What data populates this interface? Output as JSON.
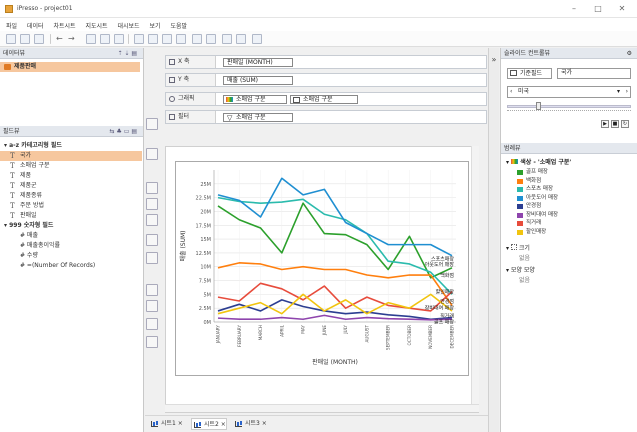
{
  "window": {
    "title": "iPresso - project01",
    "min": "–",
    "max": "□",
    "close": "✕"
  },
  "menu": [
    "파일",
    "데이터",
    "차트시트",
    "지도시트",
    "대시보드",
    "보기",
    "도움말"
  ],
  "left_panel": {
    "datasource_title": "데이터뷰",
    "datasource_item": "제품판매",
    "fields_title": "필드뷰",
    "groups": [
      {
        "label": "▾ a-z 카테고리형 필드",
        "items": [
          "국가",
          "소매업 구분",
          "제품",
          "제품군",
          "제품종류",
          "주문 방법",
          "판매일"
        ]
      },
      {
        "label": "▾ 999 숫자형 필드",
        "items": [
          "# 매출",
          "# 매출총이익률",
          "# 수량",
          "# =(Number Of Records)"
        ]
      }
    ],
    "selected_field": "국가"
  },
  "shelves": {
    "x": {
      "label": "X 축",
      "pill": "판매일 (MONTH)"
    },
    "y": {
      "label": "Y 축",
      "pill": "매출 (SUM)"
    },
    "graphic": {
      "label": "그래픽",
      "pill1": "소매업 구분",
      "pill2": "소매업 구분"
    },
    "filter": {
      "label": "필터",
      "pill": "소매업 구분"
    }
  },
  "right_panel": {
    "slider_title": "슬라이드 컨트롤뷰",
    "base_field_label": "기준필드",
    "base_field_value": "국가",
    "dropdown_value": "미국",
    "legend_title": "범례뷰",
    "color_legend_title": "색상 - '소매업 구분'",
    "legend_items": [
      {
        "label": "골프 매장",
        "color": "#2ca02c"
      },
      {
        "label": "백화점",
        "color": "#ff7f0e"
      },
      {
        "label": "스포츠 매장",
        "color": "#2bbbad"
      },
      {
        "label": "아웃도어 매장",
        "color": "#1f8fd1"
      },
      {
        "label": "안경점",
        "color": "#2c3e91"
      },
      {
        "label": "장비대여 매장",
        "color": "#8e44ad"
      },
      {
        "label": "직거래",
        "color": "#e74c3c"
      },
      {
        "label": "할인매장",
        "color": "#f1c40f"
      }
    ],
    "size_title": "크기",
    "size_value": "없음",
    "shape_title": "모양 모양",
    "shape_value": "없음"
  },
  "tabs": [
    "시트1",
    "시트2",
    "시트3"
  ],
  "chart_data": {
    "type": "line",
    "xlabel": "판매일 (MONTH)",
    "ylabel": "매출 (SUM)",
    "categories": [
      "JANUARY",
      "FEBRUARY",
      "MARCH",
      "APRIL",
      "MAY",
      "JUNE",
      "JULY",
      "AUGUST",
      "SEPTEMBER",
      "OCTOBER",
      "NOVEMBER",
      "DECEMBER"
    ],
    "y_ticks": [
      "0M",
      "2.5M",
      "5M",
      "7.5M",
      "10M",
      "12.5M",
      "15M",
      "17.5M",
      "20M",
      "22.5M",
      "25M"
    ],
    "ylim": [
      0,
      27.5
    ],
    "grid": true,
    "series": [
      {
        "name": "골프 매장",
        "color": "#2ca02c",
        "values": [
          21,
          18.5,
          17,
          12.5,
          21.5,
          16,
          15.8,
          14,
          9.5,
          15.5,
          8,
          9.8
        ]
      },
      {
        "name": "백화점",
        "color": "#ff7f0e",
        "values": [
          9.8,
          10.7,
          10.5,
          9.5,
          10,
          9.5,
          9.5,
          8.5,
          8,
          8.5,
          8.5,
          3
        ]
      },
      {
        "name": "스포츠 매장",
        "color": "#2bbbad",
        "values": [
          22.5,
          21.8,
          21.5,
          21.7,
          22.2,
          19.5,
          18.5,
          16,
          11,
          10.5,
          9,
          5
        ]
      },
      {
        "name": "아웃도어 매장",
        "color": "#1f8fd1",
        "values": [
          23,
          22,
          19,
          26,
          23,
          24,
          18,
          16,
          14,
          14,
          14,
          12
        ]
      },
      {
        "name": "안경점",
        "color": "#2c3e91",
        "values": [
          2,
          3.2,
          2,
          4,
          2.8,
          2,
          1.5,
          1.8,
          1.3,
          1,
          0.5,
          0.8
        ]
      },
      {
        "name": "장비대여 매장",
        "color": "#8e44ad",
        "values": [
          0.7,
          0.5,
          0.5,
          0.8,
          0.5,
          1.2,
          0.5,
          0.8,
          0.6,
          0.5,
          0.4,
          0.5
        ]
      },
      {
        "name": "직거래",
        "color": "#e74c3c",
        "values": [
          4.5,
          3.8,
          7,
          6,
          4,
          6.5,
          2.5,
          4.5,
          3,
          2.5,
          2,
          5.5
        ]
      },
      {
        "name": "할인매장",
        "color": "#f1c40f",
        "values": [
          1.5,
          2.5,
          3.5,
          1.5,
          5,
          2,
          4,
          1.5,
          3.5,
          2.5,
          5,
          2
        ]
      }
    ],
    "end_labels": [
      {
        "text": "스포츠매장",
        "value": 11.5
      },
      {
        "text": "아웃도어 매장",
        "value": 10.5
      },
      {
        "text": "백화점",
        "value": 8.5
      },
      {
        "text": "할인매장",
        "value": 5.5
      },
      {
        "text": "안경점",
        "value": 3.8
      },
      {
        "text": "장비대여 매장",
        "value": 2.6
      },
      {
        "text": "직거래",
        "value": 1.2
      },
      {
        "text": "골프 매장",
        "value": 0.1
      }
    ]
  }
}
